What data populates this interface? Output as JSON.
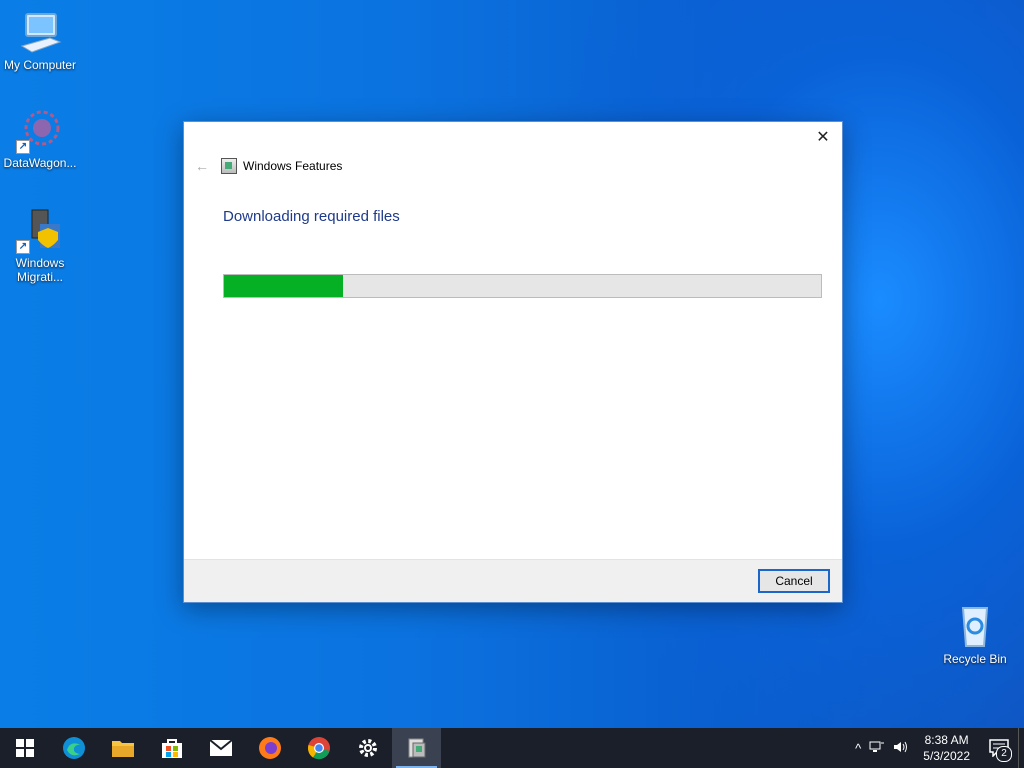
{
  "desktop": {
    "icons": [
      {
        "label": "My Computer"
      },
      {
        "label": "DataWagon..."
      },
      {
        "label": "Windows Migrati..."
      },
      {
        "label": "Recycle Bin"
      }
    ]
  },
  "dialog": {
    "title": "Windows Features",
    "heading": "Downloading required files",
    "progress_fraction": 0.2,
    "cancel_label": "Cancel",
    "close_glyph": "✕",
    "back_glyph": "←"
  },
  "taskbar": {
    "apps": [
      {
        "icon": "windows-start-icon"
      },
      {
        "icon": "edge-icon"
      },
      {
        "icon": "file-explorer-icon"
      },
      {
        "icon": "store-icon"
      },
      {
        "icon": "mail-icon"
      },
      {
        "icon": "firefox-icon"
      },
      {
        "icon": "chrome-icon"
      },
      {
        "icon": "settings-icon"
      },
      {
        "icon": "windows-features-icon"
      }
    ],
    "tray_up_glyph": "^",
    "time": "8:38 AM",
    "date": "5/3/2022",
    "notification_count": "2"
  },
  "colors": {
    "accent": "#1b66c9",
    "progress": "#06b025",
    "heading": "#1e3a8a"
  }
}
